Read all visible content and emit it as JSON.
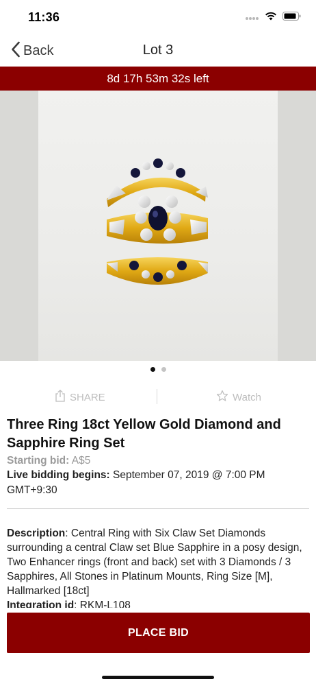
{
  "status_bar": {
    "time": "11:36",
    "icons": [
      "signal-dots-icon",
      "wifi-icon",
      "battery-icon"
    ]
  },
  "nav": {
    "back_label": "Back",
    "title": "Lot 3"
  },
  "timer": {
    "text": "8d 17h 53m 32s left",
    "color": "#8b0000"
  },
  "gallery": {
    "page_count": 2,
    "current_page": 1
  },
  "actions": {
    "share_label": "SHARE",
    "watch_label": "Watch"
  },
  "lot": {
    "title": "Three Ring 18ct Yellow Gold Diamond and Sapphire Ring Set",
    "starting_bid_label": "Starting bid:",
    "starting_bid_value": "A$5",
    "live_bidding_label": "Live bidding begins:",
    "live_bidding_value": "September 07, 2019 @ 7:00 PM GMT+9:30",
    "description_label": "Description",
    "description_text": ": Central Ring with Six Claw Set Diamonds surrounding a central Claw set Blue Sapphire in a posy design, Two Enhancer rings (front and back) set with 3 Diamonds / 3 Sapphires, All Stones in Platinum Mounts, Ring Size [M], Hallmarked [18ct]",
    "integration_label": "Integration id",
    "integration_value": ": RKM-L108"
  },
  "place_bid_label": "PLACE BID",
  "colors": {
    "brand": "#8b0000",
    "muted": "#bdbdbd"
  }
}
